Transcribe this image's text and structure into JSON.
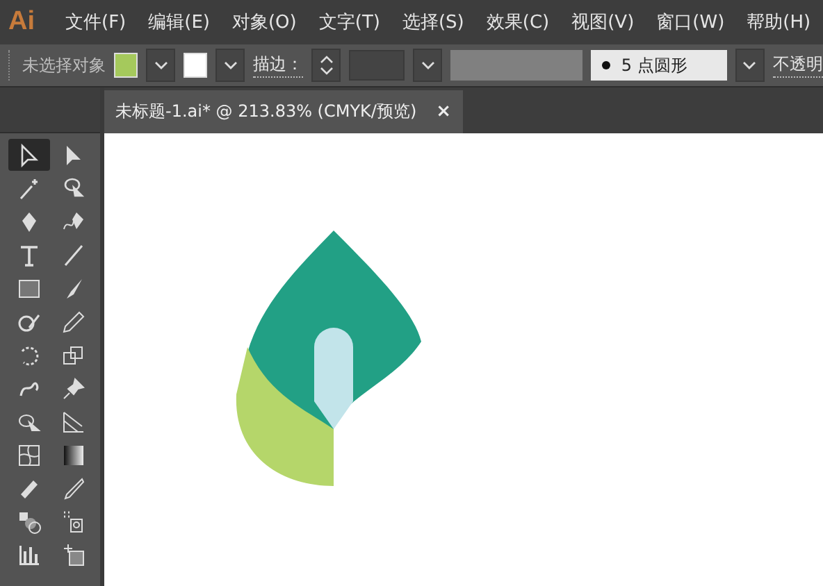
{
  "app": {
    "logo": "Ai"
  },
  "menu": [
    "文件(F)",
    "编辑(E)",
    "对象(O)",
    "文字(T)",
    "选择(S)",
    "效果(C)",
    "视图(V)",
    "窗口(W)",
    "帮助(H)"
  ],
  "control_bar": {
    "selection": "未选择对象",
    "stroke_label": "描边：",
    "brush": "5 点圆形",
    "opacity_label": "不透明"
  },
  "document_tab": {
    "title": "未标题-1.ai* @ 213.83% (CMYK/预览)",
    "close": "×"
  },
  "tools": [
    {
      "selected": true
    },
    {
      "selected": false
    },
    {
      "selected": false
    },
    {
      "selected": false
    },
    {
      "selected": false
    },
    {
      "selected": false
    },
    {
      "selected": false
    },
    {
      "selected": false
    },
    {
      "selected": false
    },
    {
      "selected": false
    },
    {
      "selected": false
    },
    {
      "selected": false
    },
    {
      "selected": false
    },
    {
      "selected": false
    },
    {
      "selected": false
    },
    {
      "selected": false
    },
    {
      "selected": false
    },
    {
      "selected": false
    },
    {
      "selected": false
    },
    {
      "selected": false
    },
    {
      "selected": false
    },
    {
      "selected": false
    },
    {
      "selected": false
    },
    {
      "selected": false
    },
    {
      "selected": false
    },
    {
      "selected": false
    }
  ]
}
